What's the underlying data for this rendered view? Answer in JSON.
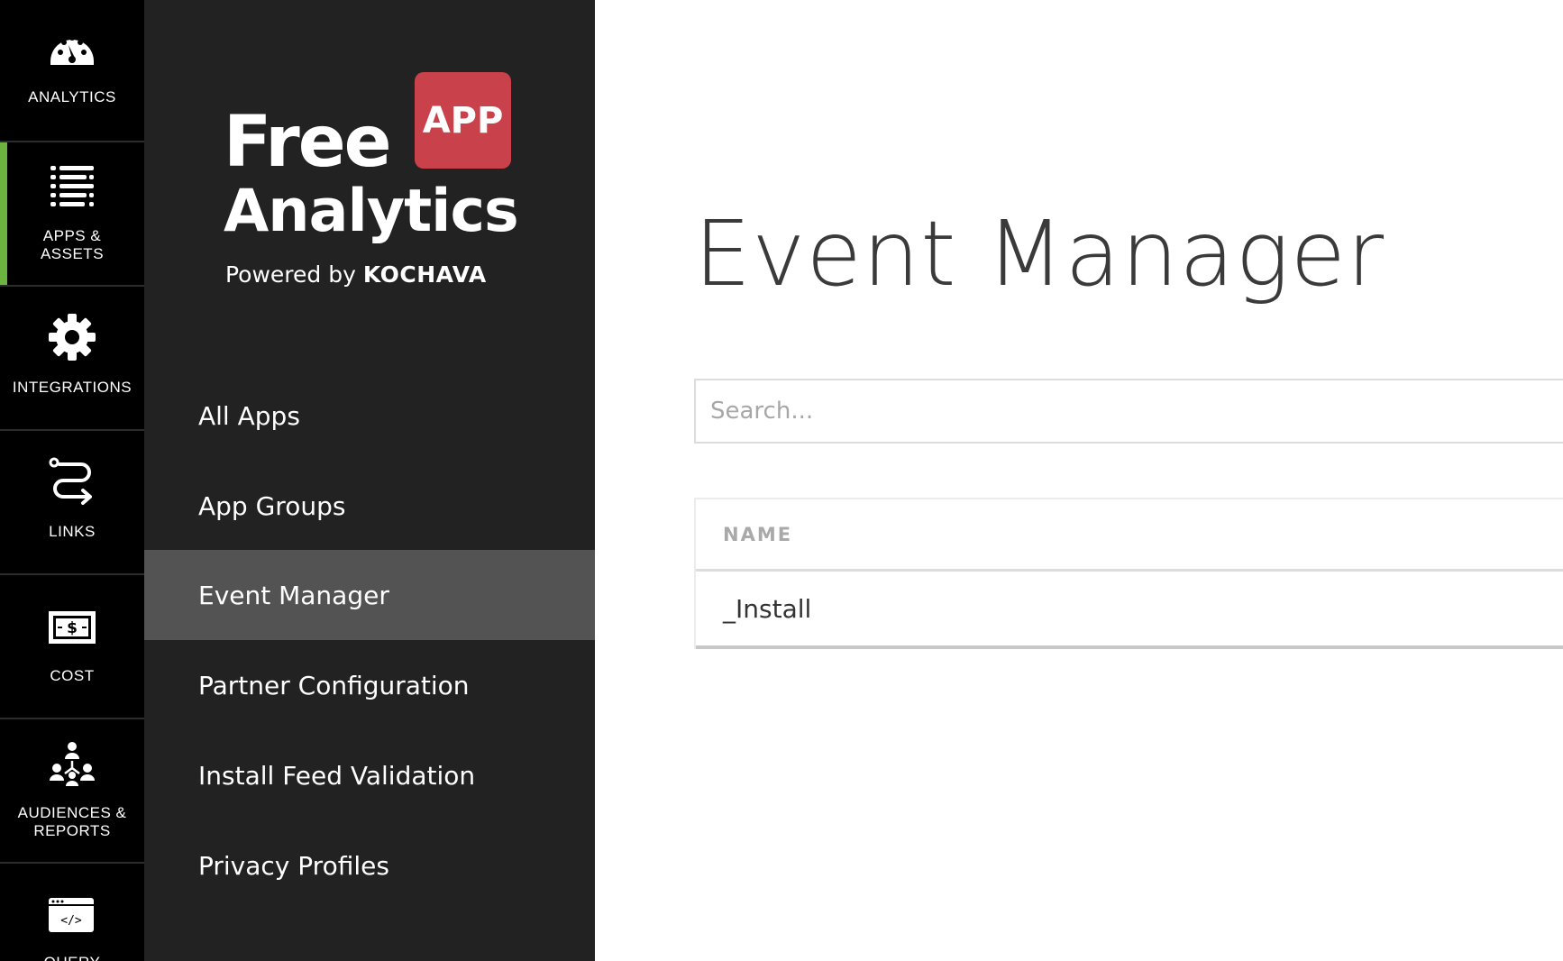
{
  "rail": {
    "items": [
      {
        "label": "ANALYTICS",
        "icon": "speedometer-icon"
      },
      {
        "label": "APPS &\nASSETS",
        "icon": "list-icon"
      },
      {
        "label": "INTEGRATIONS",
        "icon": "gear-icon"
      },
      {
        "label": "LINKS",
        "icon": "link-path-icon"
      },
      {
        "label": "COST",
        "icon": "dollar-bill-icon"
      },
      {
        "label": "AUDIENCES &\nREPORTS",
        "icon": "people-hierarchy-icon"
      },
      {
        "label": "QUERY",
        "icon": "code-window-icon"
      }
    ],
    "active_color": "#6db33f"
  },
  "logo": {
    "free": "Free",
    "badge": "APP",
    "analytics": "Analytics",
    "powered_by": "Powered by",
    "brand": "KOCHAVA",
    "badge_color": "#c9424b"
  },
  "nav": {
    "items": [
      {
        "label": "All Apps"
      },
      {
        "label": "App Groups"
      },
      {
        "label": "Event Manager",
        "active": true
      },
      {
        "label": "Partner Configuration"
      },
      {
        "label": "Install Feed Validation"
      },
      {
        "label": "Privacy Profiles"
      }
    ]
  },
  "main": {
    "title": "Event Manager",
    "search": {
      "placeholder": "Search...",
      "value": ""
    },
    "table": {
      "columns": [
        "NAME"
      ],
      "rows": [
        [
          "_Install"
        ]
      ]
    }
  }
}
